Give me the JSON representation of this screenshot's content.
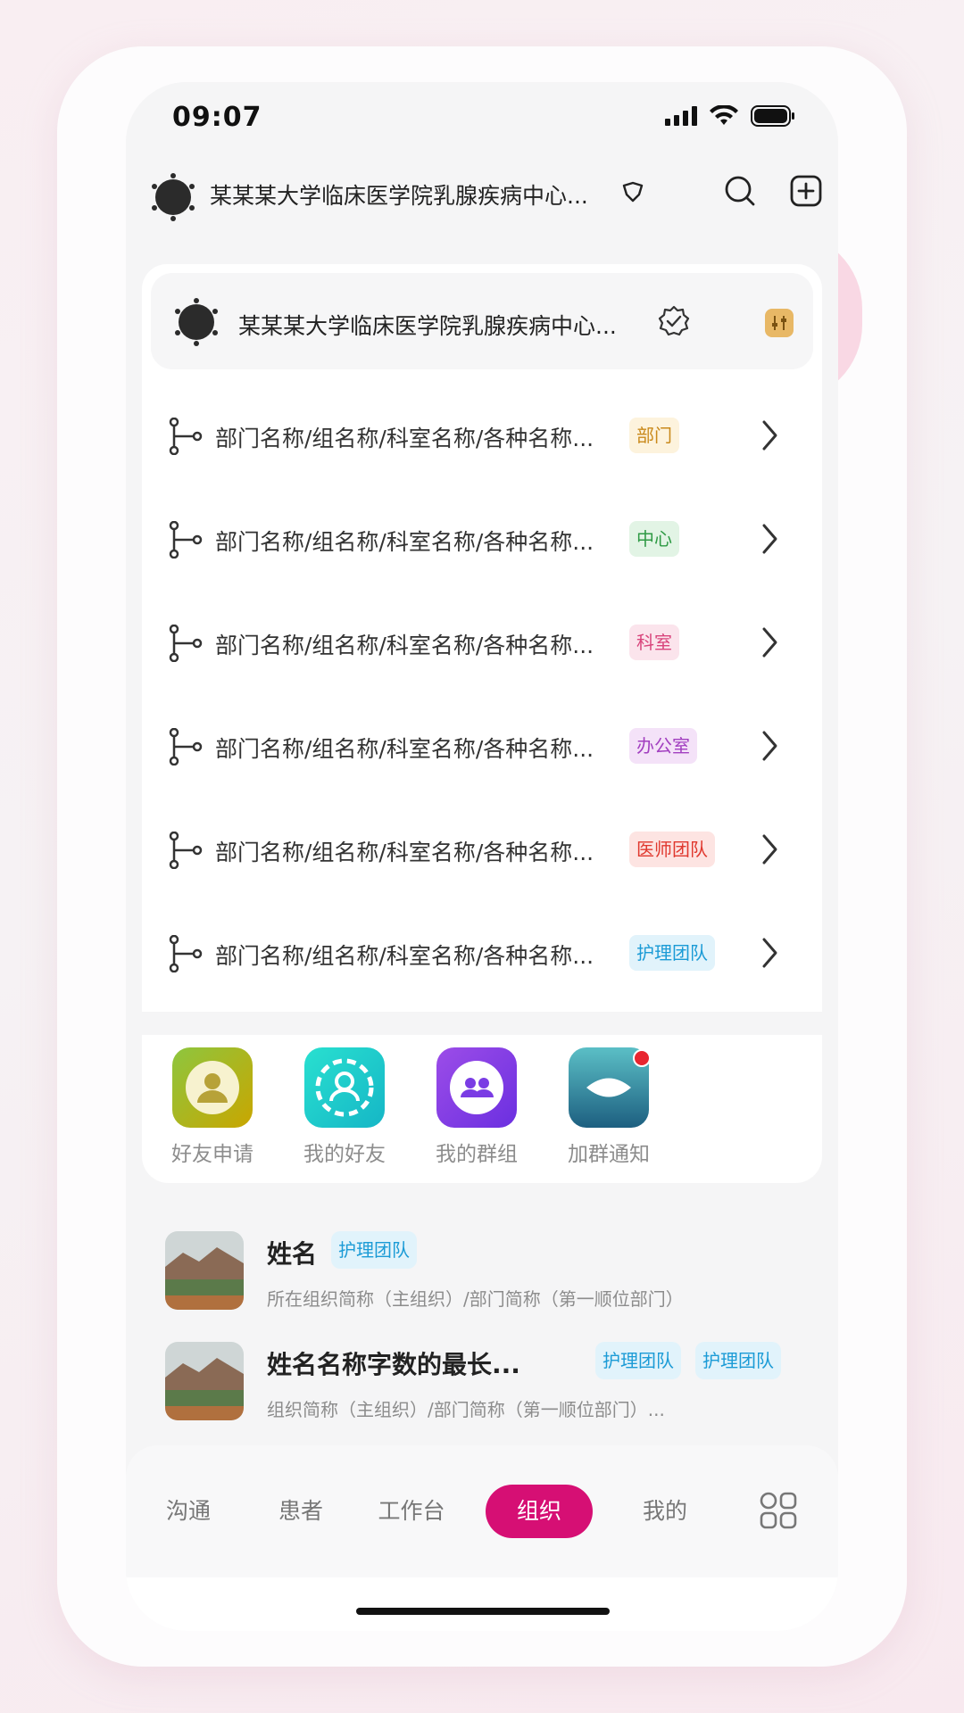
{
  "status_bar": {
    "time": "09:07"
  },
  "header": {
    "org_name": "某某某大学临床医学院乳腺疾病中心..."
  },
  "org_card": {
    "org_name": "某某某大学临床医学院乳腺疾病中心..."
  },
  "departments": [
    {
      "name": "部门名称/组名称/科室名称/各种名称...",
      "tag": "部门",
      "tag_color": "#c9891a",
      "tag_bg": "#fdf3dd"
    },
    {
      "name": "部门名称/组名称/科室名称/各种名称...",
      "tag": "中心",
      "tag_color": "#2e9a44",
      "tag_bg": "#e2f4e5"
    },
    {
      "name": "部门名称/组名称/科室名称/各种名称...",
      "tag": "科室",
      "tag_color": "#d9457c",
      "tag_bg": "#fbe4ec"
    },
    {
      "name": "部门名称/组名称/科室名称/各种名称...",
      "tag": "办公室",
      "tag_color": "#a23fc0",
      "tag_bg": "#f4e2f8"
    },
    {
      "name": "部门名称/组名称/科室名称/各种名称...",
      "tag": "医师团队",
      "tag_color": "#e0382e",
      "tag_bg": "#fde4e2"
    },
    {
      "name": "部门名称/组名称/科室名称/各种名称...",
      "tag": "护理团队",
      "tag_color": "#1b9bd6",
      "tag_bg": "#e1f3fb"
    }
  ],
  "quick_access": [
    {
      "label": "好友申请",
      "icon": "friend-request-icon"
    },
    {
      "label": "我的好友",
      "icon": "my-friends-icon"
    },
    {
      "label": "我的群组",
      "icon": "my-groups-icon"
    },
    {
      "label": "加群通知",
      "icon": "group-notice-icon"
    }
  ],
  "contacts": [
    {
      "name": "姓名",
      "tags": [
        "护理团队"
      ],
      "subtitle": "所在组织简称（主组织）/部门简称（第一顺位部门）"
    },
    {
      "name": "姓名名称字数的最长...",
      "tags": [
        "护理团队",
        "护理团队"
      ],
      "subtitle": "组织简称（主组织）/部门简称（第一顺位部门）..."
    }
  ],
  "tabbar": {
    "tabs": [
      "沟通",
      "患者",
      "工作台",
      "组织",
      "我的"
    ],
    "active": "组织"
  },
  "colors": {
    "accent": "#d60f74",
    "filter": "#e8b866"
  }
}
